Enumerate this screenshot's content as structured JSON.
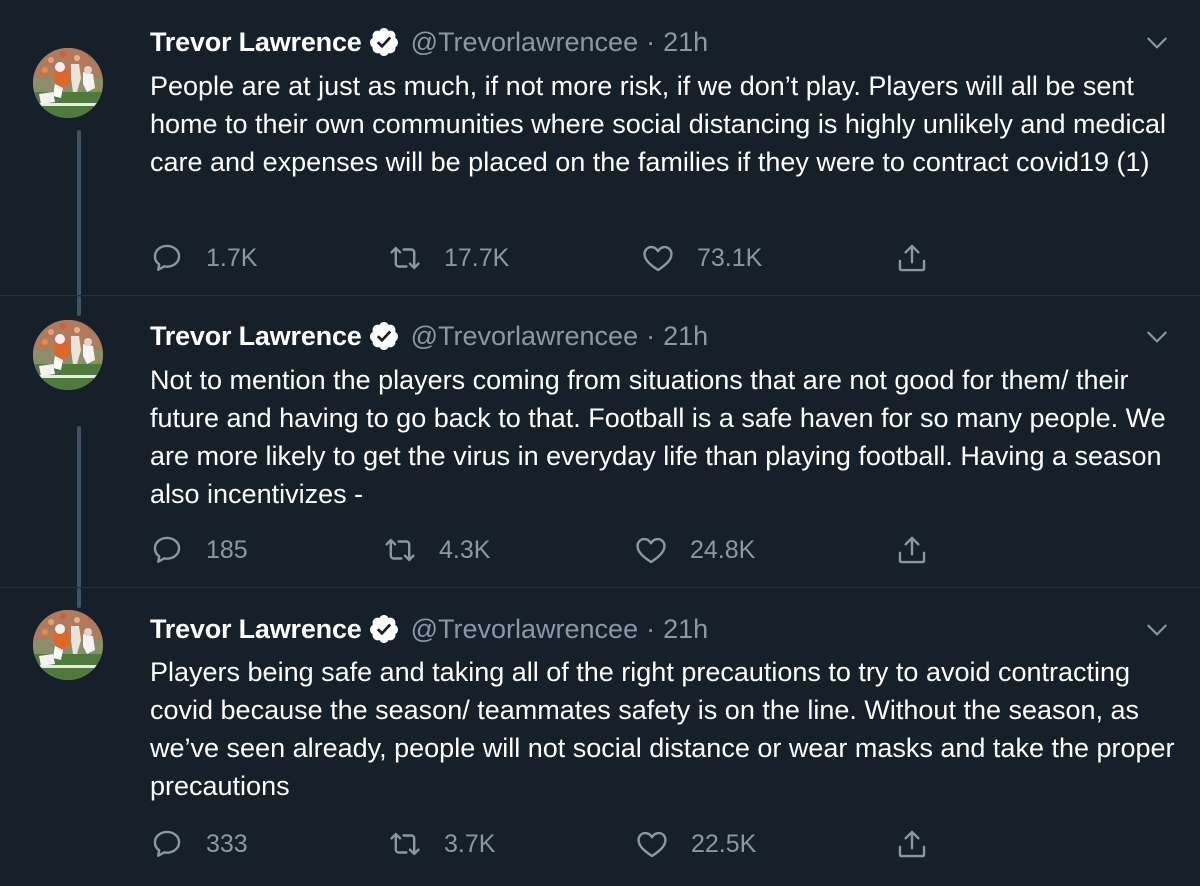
{
  "colors": {
    "background": "#15202b",
    "text": "#ffffff",
    "secondary": "#8899a6",
    "thread_line": "#3d5466",
    "divider": "#253341"
  },
  "tweets": [
    {
      "author": "Trevor Lawrence",
      "handle": "@Trevorlawrencee",
      "separator": "·",
      "time": "21h",
      "text": "People are at just as much, if not more risk, if we don’t play. Players will all be sent home to their own communities where social distancing is highly unlikely and medical care and expenses will be placed on the families if they were to contract covid19 (1)",
      "replies": "1.7K",
      "retweets": "17.7K",
      "likes": "73.1K",
      "icons": [
        "verified-badge-icon",
        "chevron-down-icon",
        "reply-icon",
        "retweet-icon",
        "like-icon",
        "share-icon"
      ]
    },
    {
      "author": "Trevor Lawrence",
      "handle": "@Trevorlawrencee",
      "separator": "·",
      "time": "21h",
      "text": "Not to mention the players coming from situations that are not good for them/ their future and having to go back to that. Football is a safe haven for so many people. We are more likely to get the virus in everyday life than playing football. Having a season also incentivizes -",
      "replies": "185",
      "retweets": "4.3K",
      "likes": "24.8K"
    },
    {
      "author": "Trevor Lawrence",
      "handle": "@Trevorlawrencee",
      "separator": "·",
      "time": "21h",
      "text": "Players being safe and taking all of the right precautions to try to avoid contracting covid because the season/ teammates safety is on the line. Without the season, as we’ve seen already, people will not social distance or wear masks and take the proper precautions",
      "replies": "333",
      "retweets": "3.7K",
      "likes": "22.5K"
    }
  ]
}
